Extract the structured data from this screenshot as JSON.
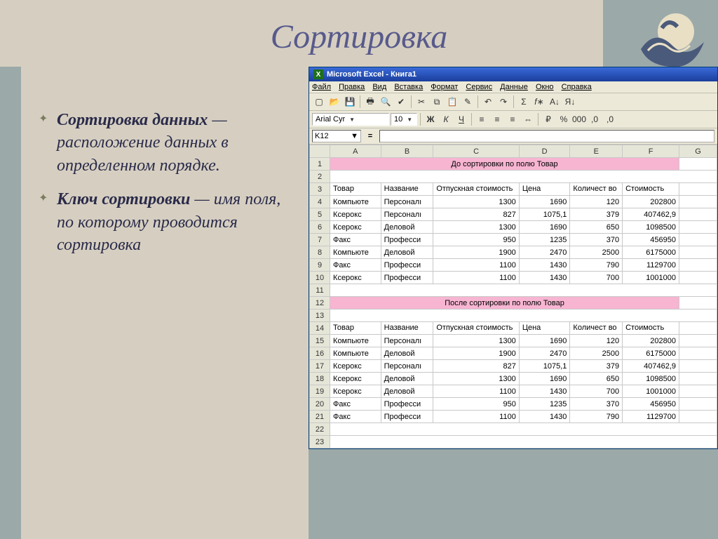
{
  "slide": {
    "title": "Сортировка",
    "bullet1_bold": "Сортировка данных",
    "bullet1_rest": " — расположение данных в определенном порядке.",
    "bullet2_bold": "Ключ сортировки",
    "bullet2_rest": " — имя поля, по которому проводится сортировка"
  },
  "excel": {
    "title": "Microsoft Excel - Книга1",
    "menu": [
      "Файл",
      "Правка",
      "Вид",
      "Вставка",
      "Формат",
      "Сервис",
      "Данные",
      "Окно",
      "Справка"
    ],
    "font_name": "Arial Cyr",
    "font_size": "10",
    "name_box": "K12",
    "cols": [
      "A",
      "B",
      "C",
      "D",
      "E",
      "F",
      "G"
    ],
    "title1": "До сортировки по полю Товар",
    "title2": "После сортировки по полю Товар",
    "headers": {
      "c1": "Товар",
      "c2": "Название",
      "c3": "Отпускная стоимость",
      "c4": "Цена",
      "c5": "Количест во",
      "c6": "Стоимость"
    },
    "rows_before": [
      {
        "n": "4",
        "a": "Компьюте",
        "b": "Персоналı",
        "c": "1300",
        "d": "1690",
        "e": "120",
        "f": "202800"
      },
      {
        "n": "5",
        "a": "Ксерокс",
        "b": "Персоналı",
        "c": "827",
        "d": "1075,1",
        "e": "379",
        "f": "407462,9"
      },
      {
        "n": "6",
        "a": "Ксерокс",
        "b": "Деловой",
        "c": "1300",
        "d": "1690",
        "e": "650",
        "f": "1098500"
      },
      {
        "n": "7",
        "a": "Факс",
        "b": "Професси",
        "c": "950",
        "d": "1235",
        "e": "370",
        "f": "456950"
      },
      {
        "n": "8",
        "a": "Компьюте",
        "b": "Деловой",
        "c": "1900",
        "d": "2470",
        "e": "2500",
        "f": "6175000"
      },
      {
        "n": "9",
        "a": "Факс",
        "b": "Професси",
        "c": "1100",
        "d": "1430",
        "e": "790",
        "f": "1129700"
      },
      {
        "n": "10",
        "a": "Ксерокс",
        "b": "Професси",
        "c": "1100",
        "d": "1430",
        "e": "700",
        "f": "1001000"
      }
    ],
    "rows_after": [
      {
        "n": "15",
        "a": "Компьюте",
        "b": "Персоналı",
        "c": "1300",
        "d": "1690",
        "e": "120",
        "f": "202800"
      },
      {
        "n": "16",
        "a": "Компьюте",
        "b": "Деловой",
        "c": "1900",
        "d": "2470",
        "e": "2500",
        "f": "6175000"
      },
      {
        "n": "17",
        "a": "Ксерокс",
        "b": "Персоналı",
        "c": "827",
        "d": "1075,1",
        "e": "379",
        "f": "407462,9"
      },
      {
        "n": "18",
        "a": "Ксерокс",
        "b": "Деловой",
        "c": "1300",
        "d": "1690",
        "e": "650",
        "f": "1098500"
      },
      {
        "n": "19",
        "a": "Ксерокс",
        "b": "Деловой",
        "c": "1100",
        "d": "1430",
        "e": "700",
        "f": "1001000"
      },
      {
        "n": "20",
        "a": "Факс",
        "b": "Професси",
        "c": "950",
        "d": "1235",
        "e": "370",
        "f": "456950"
      },
      {
        "n": "21",
        "a": "Факс",
        "b": "Професси",
        "c": "1100",
        "d": "1430",
        "e": "790",
        "f": "1129700"
      }
    ]
  }
}
